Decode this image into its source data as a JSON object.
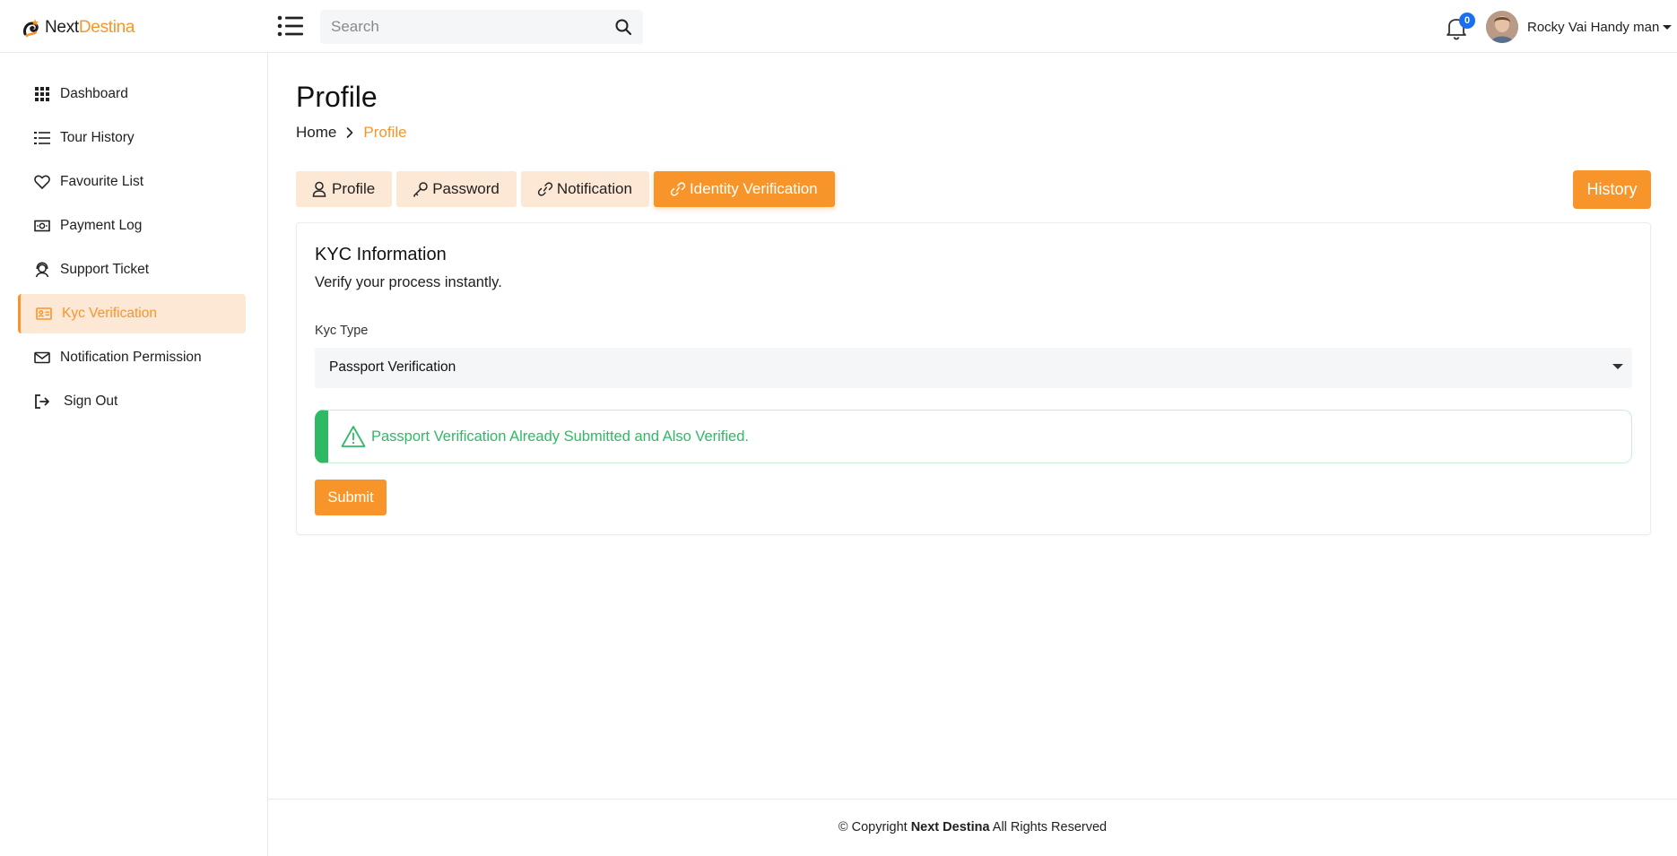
{
  "header": {
    "brand_part1": "Next",
    "brand_part2": "Destina",
    "search_placeholder": "Search",
    "notification_count": "0",
    "user_name": "Rocky Vai Handy man"
  },
  "sidebar": {
    "items": [
      {
        "label": "Dashboard",
        "icon": "grid-icon"
      },
      {
        "label": "Tour History",
        "icon": "list-icon"
      },
      {
        "label": "Favourite List",
        "icon": "heart-icon"
      },
      {
        "label": "Payment Log",
        "icon": "money-icon"
      },
      {
        "label": "Support Ticket",
        "icon": "support-icon"
      },
      {
        "label": "Kyc Verification",
        "icon": "id-card-icon",
        "active": true
      },
      {
        "label": "Notification Permission",
        "icon": "envelope-icon"
      },
      {
        "label": "Sign Out",
        "icon": "sign-out-icon"
      }
    ]
  },
  "page": {
    "title": "Profile",
    "breadcrumb_home": "Home",
    "breadcrumb_current": "Profile"
  },
  "tabs": [
    {
      "label": "Profile",
      "icon": "user-icon"
    },
    {
      "label": "Password",
      "icon": "key-icon"
    },
    {
      "label": "Notification",
      "icon": "link-icon"
    },
    {
      "label": "Identity Verification",
      "icon": "link-icon",
      "active": true
    }
  ],
  "history_button": "History",
  "kyc": {
    "title": "KYC Information",
    "subtitle": "Verify your process instantly.",
    "type_label": "Kyc Type",
    "type_value": "Passport Verification",
    "alert_text": "Passport Verification Already Submitted and Also Verified.",
    "submit_label": "Submit"
  },
  "footer": {
    "prefix": "© Copyright ",
    "brand": "Next Destina",
    "suffix": " All Rights Reserved"
  },
  "colors": {
    "accent": "#f7952b",
    "accent_light": "#fde8d6",
    "success": "#2fb965",
    "badge": "#1a6ef0"
  }
}
